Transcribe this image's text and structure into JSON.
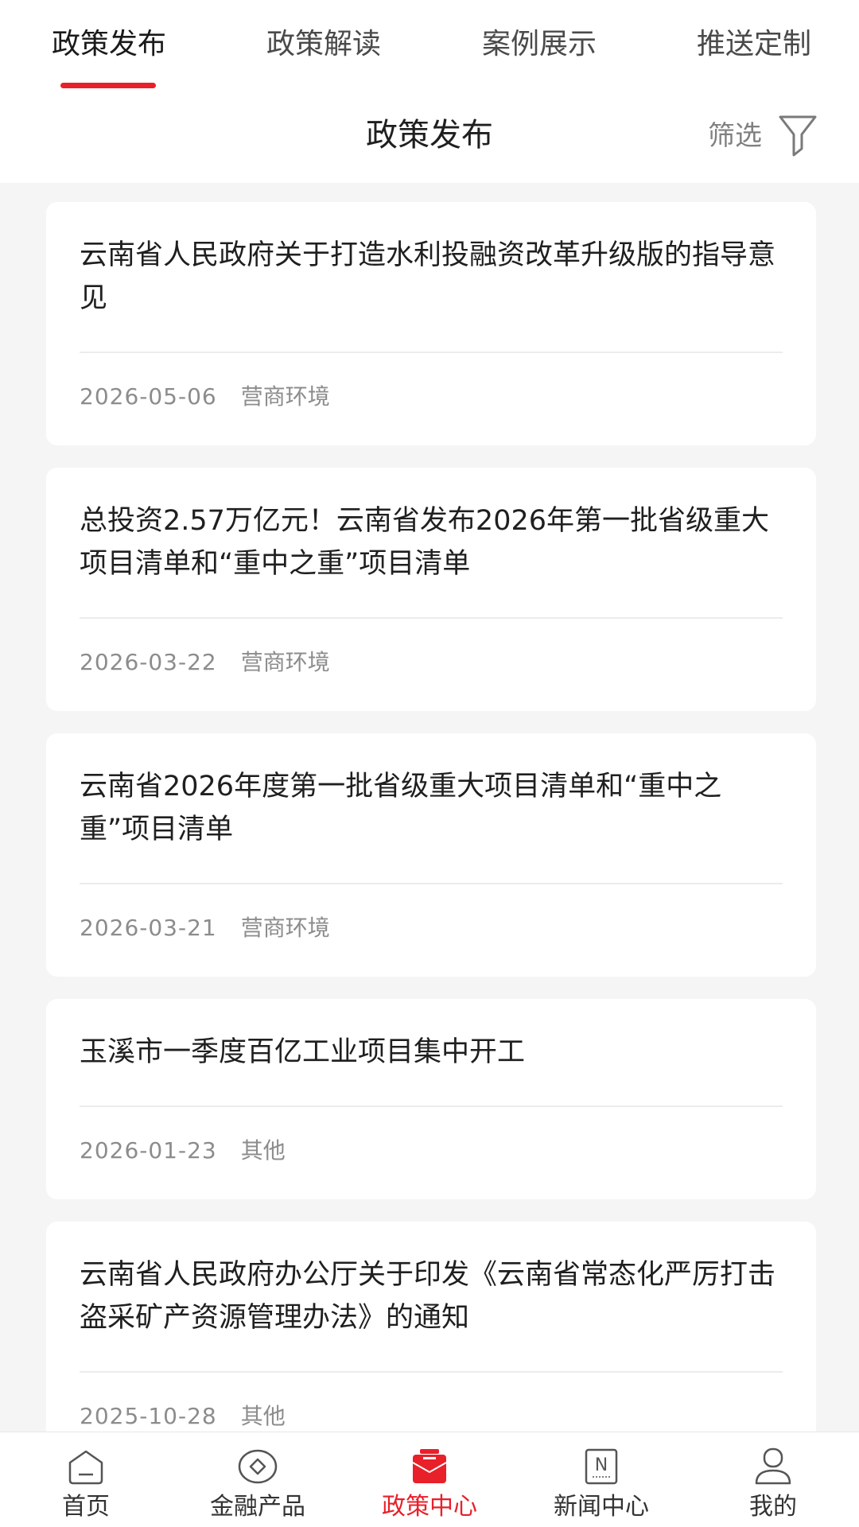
{
  "tabs": [
    {
      "label": "政策发布",
      "active": true
    },
    {
      "label": "政策解读",
      "active": false
    },
    {
      "label": "案例展示",
      "active": false
    },
    {
      "label": "推送定制",
      "active": false
    }
  ],
  "header": {
    "title": "政策发布",
    "filter_label": "筛选",
    "filter_icon": "funnel-icon"
  },
  "policies": [
    {
      "title": "云南省人民政府关于打造水利投融资改革升级版的指导意见",
      "date": "2026-05-06",
      "category": "营商环境"
    },
    {
      "title": "总投资2.57万亿元！云南省发布2026年第一批省级重大项目清单和“重中之重”项目清单",
      "date": "2026-03-22",
      "category": "营商环境"
    },
    {
      "title": "云南省2026年度第一批省级重大项目清单和“重中之重”项目清单",
      "date": "2026-03-21",
      "category": "营商环境"
    },
    {
      "title": "玉溪市一季度百亿工业项目集中开工",
      "date": "2026-01-23",
      "category": "其他"
    },
    {
      "title": "云南省人民政府办公厅关于印发《云南省常态化严厉打击盗采矿产资源管理办法》的通知",
      "date": "2025-10-28",
      "category": "其他"
    }
  ],
  "bottom_nav": [
    {
      "label": "首页",
      "icon": "home-icon",
      "active": false
    },
    {
      "label": "金融产品",
      "icon": "finance-coin-icon",
      "active": false
    },
    {
      "label": "政策中心",
      "icon": "policy-folder-icon",
      "active": true
    },
    {
      "label": "新闻中心",
      "icon": "news-icon",
      "active": false
    },
    {
      "label": "我的",
      "icon": "profile-icon",
      "active": false
    }
  ],
  "colors": {
    "accent": "#e8202a",
    "background": "#f5f5f5",
    "card": "#ffffff",
    "meta_text": "#8c8c8c"
  }
}
